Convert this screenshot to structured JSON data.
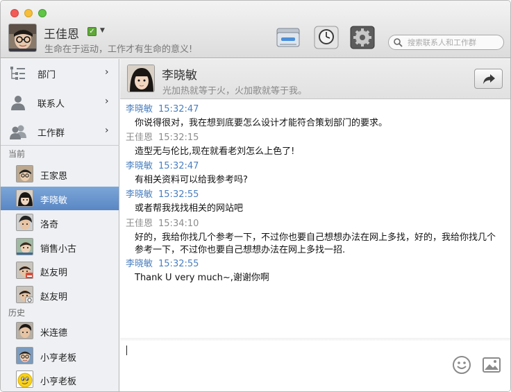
{
  "window": {
    "controls": [
      "close",
      "minimize",
      "zoom"
    ]
  },
  "me": {
    "name": "王佳恩",
    "status_icon": "check-icon",
    "motto": "生命在于运动，工作才有生命的意义!"
  },
  "toolbar": {
    "buttons": [
      "files-icon",
      "clock-icon",
      "gear-icon"
    ],
    "search_placeholder": "搜索联系人和工作群"
  },
  "sidebar": {
    "nav": [
      {
        "label": "部门",
        "icon": "org-tree-icon"
      },
      {
        "label": "联系人",
        "icon": "person-icon"
      },
      {
        "label": "工作群",
        "icon": "group-icon"
      }
    ],
    "current_label": "当前",
    "current": [
      {
        "name": "王家恩"
      },
      {
        "name": "李晓敏",
        "selected": true
      },
      {
        "name": "洛奇"
      },
      {
        "name": "销售小古"
      },
      {
        "name": "赵友明"
      },
      {
        "name": "赵友明"
      }
    ],
    "history_label": "历史",
    "history": [
      {
        "name": "米连德"
      },
      {
        "name": "小亨老板"
      },
      {
        "name": "小亨老板"
      }
    ]
  },
  "chat": {
    "peer_name": "李晓敏",
    "peer_motto": "光加热就等于火，火加歌就等于我。",
    "messages": [
      {
        "sender": "李晓敏",
        "time": "15:32:47",
        "text": "你说得很对，我在想到底要怎么设计才能符合策划部门的要求。",
        "from": "peer"
      },
      {
        "sender": "王佳恩",
        "time": "15:32:15",
        "text": "造型无与伦比,现在就看老刘怎么上色了!",
        "from": "self"
      },
      {
        "sender": "李晓敏",
        "time": "15:32:47",
        "text": "有相关资料可以给我参考吗?",
        "from": "peer"
      },
      {
        "sender": "李晓敏",
        "time": "15:32:55",
        "text": "或者帮我找找相关的网站吧",
        "from": "peer"
      },
      {
        "sender": "王佳恩",
        "time": "15:34:10",
        "text": "好的，我给你找几个参考一下，不过你也要自己想想办法在网上多找，好的，我给你找几个参考一下，不过你也要自己想想办法在网上多找一招.",
        "from": "self"
      },
      {
        "sender": "李晓敏",
        "time": "15:32:55",
        "text": "Thank U very much~,谢谢你啊",
        "from": "peer"
      }
    ],
    "input_value": ""
  },
  "colors": {
    "accent": "#5a86c4",
    "peer_name": "#4a7fbf",
    "self_name": "#8c8c8c"
  }
}
